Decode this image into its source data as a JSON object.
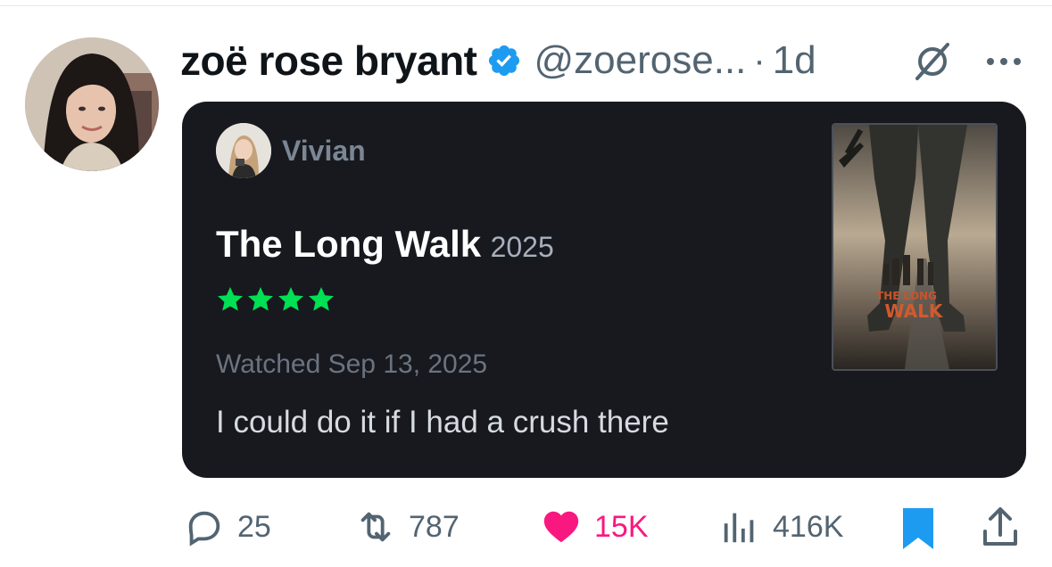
{
  "author": {
    "display_name": "zoë rose bryant",
    "handle": "@zoerose...",
    "separator": "·",
    "time": "1d",
    "verified": true,
    "verified_color": "#1d9bf0"
  },
  "card": {
    "reviewer_name": "Vivian",
    "film_title": "The Long Walk",
    "film_year": "2025",
    "star_count": 4,
    "star_color": "#00e054",
    "watched": "Watched Sep 13, 2025",
    "review_text": "I could do it if I had a crush there",
    "poster_text": "THE LONG WALK"
  },
  "actions": {
    "replies": "25",
    "reposts": "787",
    "likes": "15K",
    "views": "416K",
    "like_color": "#f91880",
    "bookmark_color": "#1d9bf0"
  },
  "icons": [
    "verified-badge-icon",
    "grok-icon",
    "more-icon",
    "reply-icon",
    "repost-icon",
    "heart-icon",
    "views-icon",
    "bookmark-icon",
    "share-icon"
  ]
}
